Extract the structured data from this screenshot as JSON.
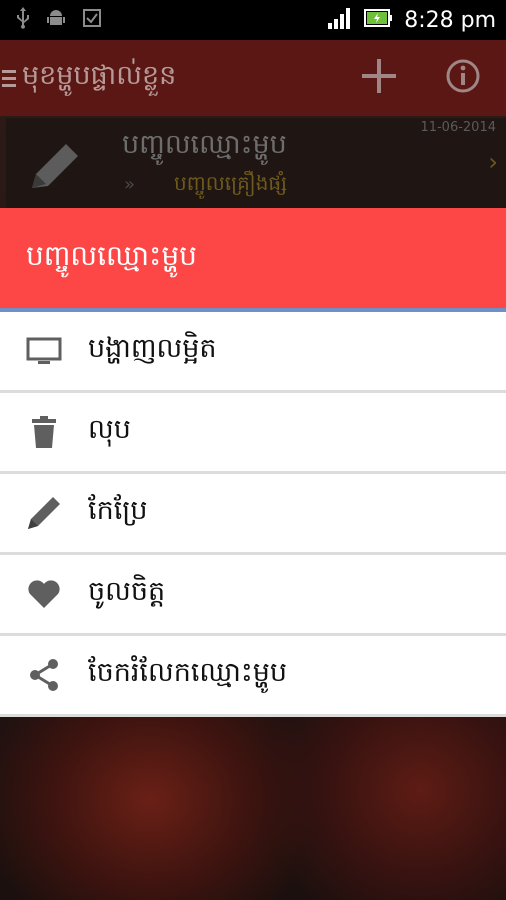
{
  "statusbar": {
    "time": "8:28 pm"
  },
  "app": {
    "title": "មុខម្ហូបផ្ទាល់ខ្លួន"
  },
  "list_item": {
    "title": "បញ្ចូលឈ្មោះម្ហូប",
    "date": "11-06-2014",
    "subtitle": "បញ្ចូលគ្រឿងផ្សំ",
    "bullet": "»"
  },
  "dialog": {
    "title": "បញ្ចូលឈ្មោះម្ហូប",
    "items": [
      {
        "label": "បង្ហាញលម្អិត",
        "icon": "monitor-icon"
      },
      {
        "label": "លុប",
        "icon": "trash-icon"
      },
      {
        "label": "កែប្រែ",
        "icon": "pencil-icon"
      },
      {
        "label": "ចូលចិត្ត",
        "icon": "heart-icon"
      },
      {
        "label": "ចែករំលែកឈ្មោះម្ហូប",
        "icon": "share-icon"
      }
    ]
  },
  "colors": {
    "dialog_header": "#fd4646",
    "actionbar": "#5a1714",
    "divider": "#6f8fc6"
  }
}
